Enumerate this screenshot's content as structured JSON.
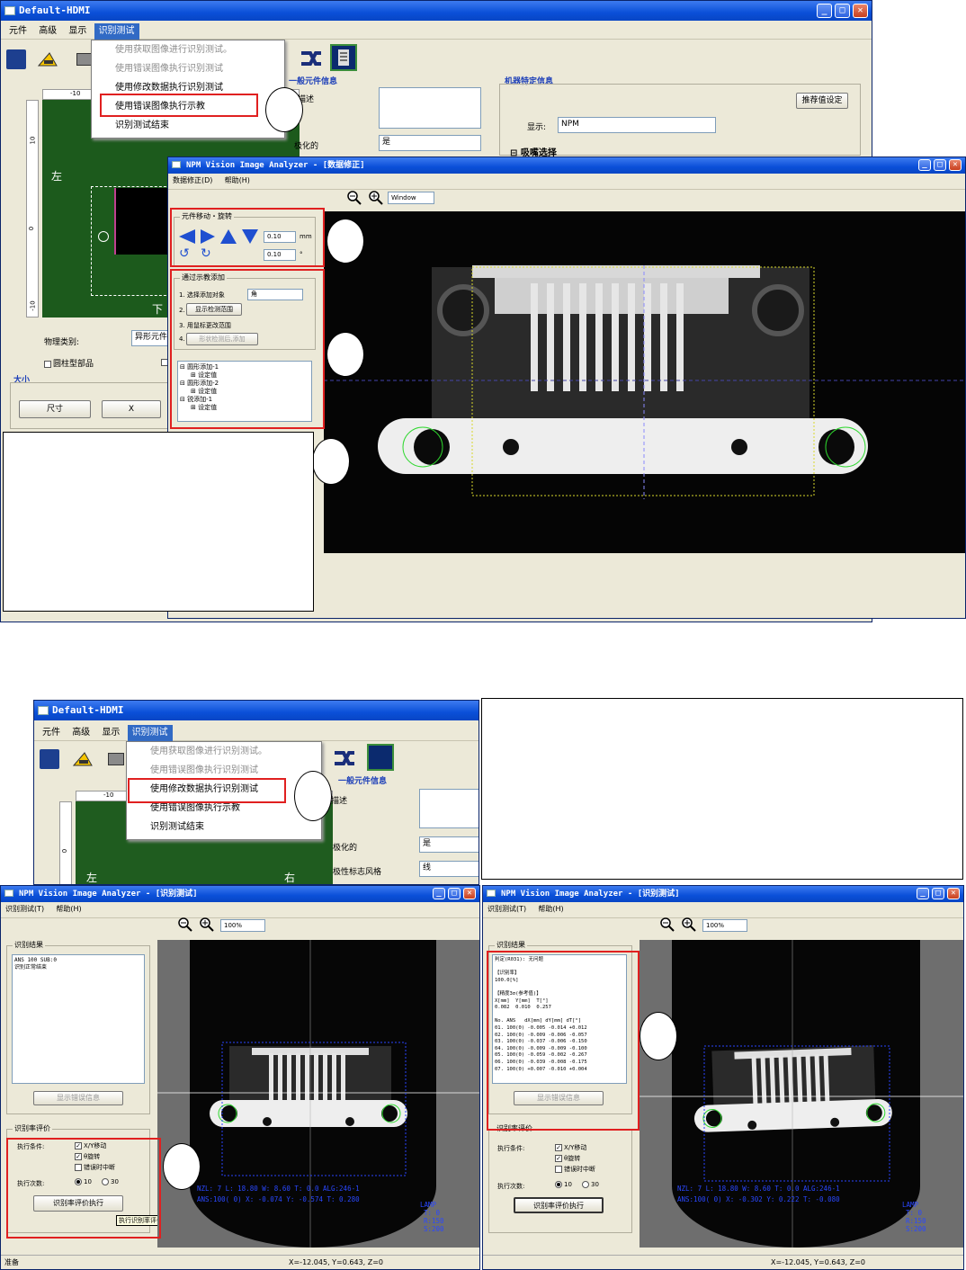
{
  "top": {
    "main_title": "Default-HDMI",
    "menu": [
      "元件",
      "高级",
      "显示",
      "识别测试"
    ],
    "dropdown": [
      "使用获取图像进行识别测试。",
      "使用错误图像执行识别测试",
      "使用修改数据执行识别测试",
      "使用错误图像执行示教",
      "识别测试结束"
    ],
    "callout_number": "",
    "general_info": "一般元件信息",
    "description_label": "描述",
    "polarized_label": "极化的",
    "polarized_value": "是",
    "machine_info": "机器特定信息",
    "recommend_button": "推荐值设定",
    "display_label": "显示:",
    "display_value": "NPM",
    "nozzle_select": "吸嘴选择",
    "left_label": "左",
    "bottom_label": "下",
    "ruler_top": "-10",
    "ruler_left_a": "10",
    "ruler_left_b": "0",
    "ruler_left_c": "-10",
    "physical_type_label": "物理类别:",
    "physical_type_value": "异形元件",
    "cylinder_label": "圆柱型部品",
    "size_label": "大小",
    "size_button": "尺寸",
    "x_button": "X"
  },
  "analyzer": {
    "title": "NPM Vision Image Analyzer - [数据修正]",
    "menu": [
      "数据修正(D)",
      "帮助(H)"
    ],
    "zoom_value": "Window",
    "move_group": "元件移动・旋转",
    "move_step": "0.10",
    "move_unit": "mm",
    "rotate_step": "0.10",
    "rotate_unit": "°",
    "add_group": "通过示教添加",
    "steps": [
      "1. 选择添加对象",
      "2.",
      "3. 用鼠标更改范围",
      "4."
    ],
    "target_value": "角",
    "show_range_button": "显示检测范围",
    "add_button": "形状检测后,添加",
    "tree": [
      "圆形添加-1",
      "设定值",
      "圆形添加-2",
      "设定值",
      "锐添加-1",
      "设定值"
    ]
  },
  "bottom": {
    "main_title": "Default-HDMI",
    "menu": [
      "元件",
      "高级",
      "显示",
      "识别测试"
    ],
    "dropdown": [
      "使用获取图像进行识别测试。",
      "使用错误图像执行识别测试",
      "使用修改数据执行识别测试",
      "使用错误图像执行示教",
      "识别测试结束"
    ],
    "general_info": "一般元件信息",
    "description_label": "描述",
    "polarized_label": "极化的",
    "polarized_value": "是",
    "polarity_style_label": "极性标志风格",
    "polarity_style_value": "线",
    "ruler_top": "-10",
    "ruler_left_a": "0",
    "ruler_left_b": "0",
    "left_label": "左",
    "right_label": "右"
  },
  "test_left": {
    "title": "NPM Vision Image Analyzer - [识别测试]",
    "menu": [
      "识别测试(T)",
      "帮助(H)"
    ],
    "zoom_value": "100%",
    "result_group": "识别结果",
    "result_text": "ANS 100 SUB:0\n识别正常结束",
    "show_error_button": "显示错误信息",
    "rate_group": "识别率评价",
    "cond_label": "执行条件:",
    "cond_xy": "X/Y移动",
    "cond_theta": "θ旋转",
    "cond_stop": "错误时中断",
    "count_label": "执行次数:",
    "count_10": "10",
    "count_30": "30",
    "exec_button": "识别率评价执行",
    "tooltip": "执行识别率评价。",
    "overlay_line1": "NZL: 7 L: 18.80 W:  8.60 T:   0.0 ALG:246-1",
    "overlay_line2": "ANS:100( 0)  X: -0.074 Y: -0.574 T:   0.280",
    "lamp_labels": [
      "LAMP",
      "T:  0",
      "R:150",
      "S:200"
    ],
    "status_left": "准备",
    "status_coords": "X=-12.045, Y=0.643, Z=0"
  },
  "test_right": {
    "title": "NPM Vision Image Analyzer - [识别测试]",
    "menu": [
      "识别测试(T)",
      "帮助(H)"
    ],
    "zoom_value": "100%",
    "result_group": "识别结果",
    "result_text": "判定(R031): 无问题\n\n【识别率】\n100.0[%]\n\n【精度3σ(参考值)】\nX[mm]  Y[mm]  T[°]\n0.082  0.010  0.257\n\nNo. ANS   dX[mm] dY[mm] dT[°]\n01. 100(0) -0.005 -0.014 +0.012\n02. 100(0) -0.009 -0.006 -0.057\n03. 100(0) -0.037 -0.006 -0.150\n04. 100(0) -0.009 -0.009 -0.100\n05. 100(0) -0.059 -0.002 -0.267\n06. 100(0) -0.039 -0.008 -0.175\n07. 100(0) +0.007 -0.010 +0.004",
    "show_error_button": "显示错误信息",
    "rate_group": "识别率评价",
    "cond_label": "执行条件:",
    "cond_xy": "X/Y移动",
    "cond_theta": "θ旋转",
    "cond_stop": "错误时中断",
    "count_label": "执行次数:",
    "count_10": "10",
    "count_30": "30",
    "exec_button": "识别率评价执行",
    "overlay_line1": "NZL: 7 L: 18.80 W:  8.60 T:   0.0 ALG:246-1",
    "overlay_line2": "ANS:100( 0)  X: -0.302 Y:  0.222 T:  -0.080",
    "lamp_labels": [
      "LAMP",
      "T:  0",
      "R:150",
      "S:200"
    ],
    "status_coords": "X=-12.045, Y=0.643, Z=0"
  }
}
